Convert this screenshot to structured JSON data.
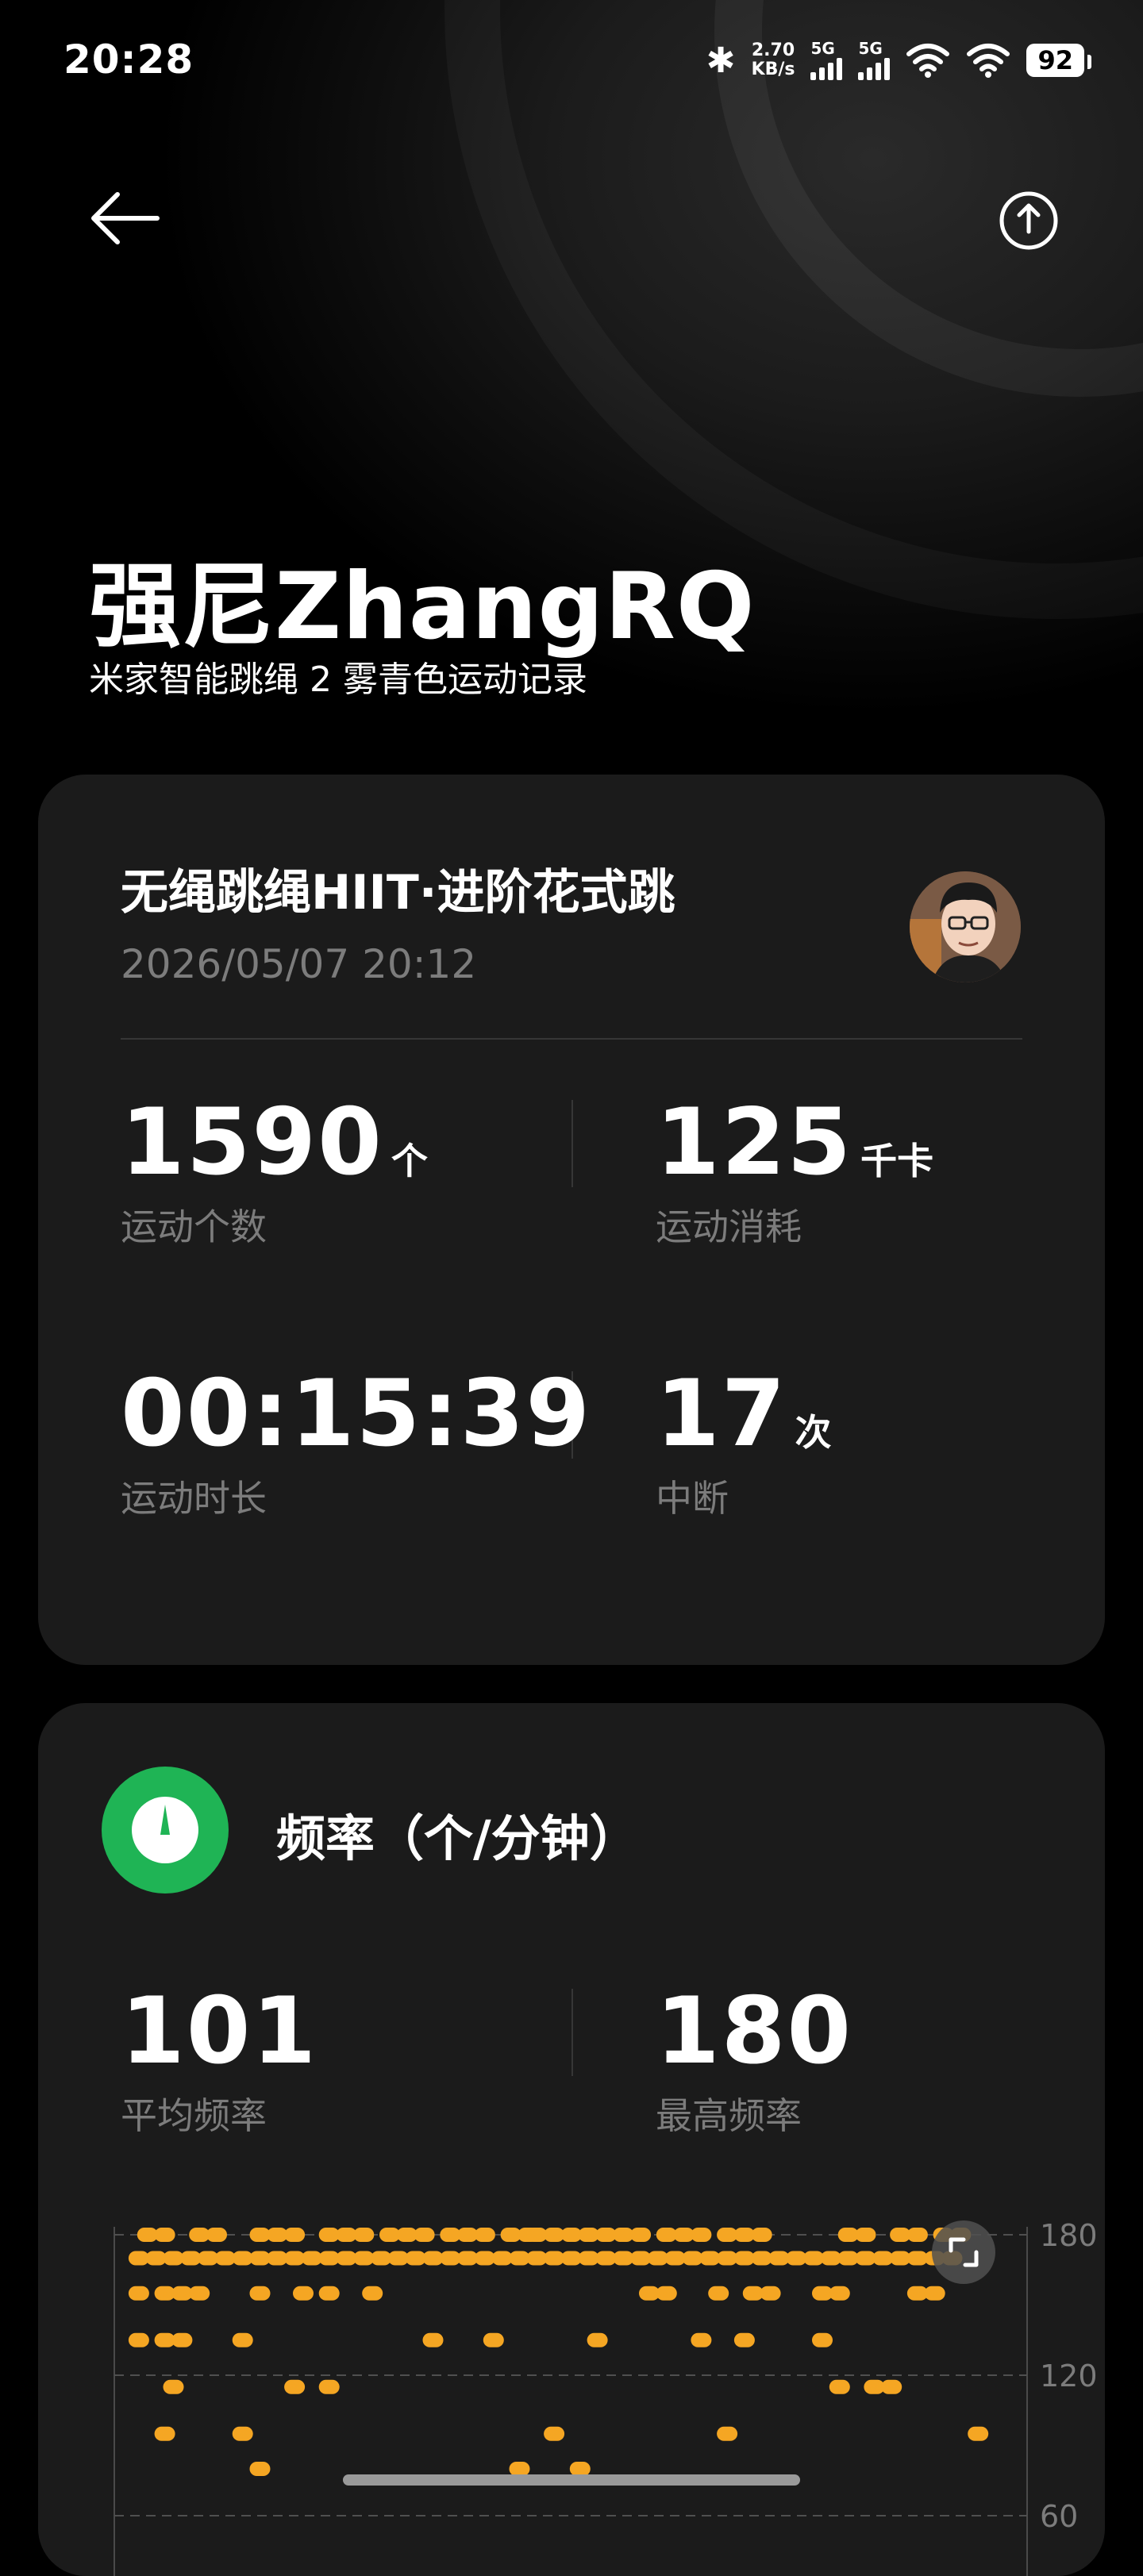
{
  "status_bar": {
    "time": "20:28",
    "net_speed_value": "2.70",
    "net_speed_unit": "KB/s",
    "sim1_label": "5G",
    "sim2_label": "5G",
    "battery": "92",
    "icons": [
      "bluetooth-icon",
      "signal-icon",
      "wifi-icon",
      "battery-icon"
    ]
  },
  "nav": {
    "back_icon": "arrow-left-icon",
    "share_icon": "share-icon"
  },
  "header": {
    "title": "强尼ZhangRQ",
    "subtitle": "米家智能跳绳 2 雾青色运动记录"
  },
  "workout": {
    "title": "无绳跳绳HIIT·进阶花式跳",
    "datetime": "2026/05/07 20:12",
    "stats": [
      {
        "value": "1590",
        "unit": "个",
        "label": "运动个数"
      },
      {
        "value": "125",
        "unit": "千卡",
        "label": "运动消耗"
      },
      {
        "value": "00:15:39",
        "unit": "",
        "label": "运动时长"
      },
      {
        "value": "17",
        "unit": "次",
        "label": "中断"
      }
    ]
  },
  "frequency": {
    "icon": "speedometer-icon",
    "title": "频率（个/分钟）",
    "stats": [
      {
        "value": "101",
        "label": "平均频率"
      },
      {
        "value": "180",
        "label": "最高频率"
      }
    ]
  },
  "chart_data": {
    "type": "scatter",
    "title": "",
    "xlabel": "",
    "ylabel": "",
    "y_ticks": [
      180,
      120,
      60
    ],
    "grid": true,
    "color": "#f5a623",
    "rows": [
      {
        "y": 180,
        "x": [
          0.02,
          0.04,
          0.08,
          0.1,
          0.15,
          0.17,
          0.19,
          0.23,
          0.25,
          0.27,
          0.3,
          0.32,
          0.34,
          0.37,
          0.39,
          0.41,
          0.44,
          0.46,
          0.47,
          0.49,
          0.51,
          0.53,
          0.55,
          0.57,
          0.59,
          0.62,
          0.64,
          0.66,
          0.69,
          0.71,
          0.73,
          0.83,
          0.85,
          0.89,
          0.91,
          0.94,
          0.96
        ]
      },
      {
        "y": 170,
        "x": [
          0.01,
          0.03,
          0.05,
          0.07,
          0.09,
          0.11,
          0.13,
          0.15,
          0.17,
          0.19,
          0.21,
          0.23,
          0.25,
          0.27,
          0.29,
          0.31,
          0.33,
          0.35,
          0.37,
          0.39,
          0.41,
          0.43,
          0.45,
          0.47,
          0.49,
          0.51,
          0.53,
          0.55,
          0.57,
          0.59,
          0.61,
          0.63,
          0.65,
          0.67,
          0.69,
          0.71,
          0.73,
          0.75,
          0.77,
          0.79,
          0.81,
          0.83,
          0.85,
          0.87,
          0.89,
          0.91,
          0.93,
          0.95
        ]
      },
      {
        "y": 155,
        "x": [
          0.01,
          0.04,
          0.06,
          0.08,
          0.15,
          0.2,
          0.23,
          0.28,
          0.6,
          0.62,
          0.68,
          0.72,
          0.74,
          0.8,
          0.82,
          0.91,
          0.93
        ]
      },
      {
        "y": 135,
        "x": [
          0.01,
          0.04,
          0.06,
          0.13,
          0.35,
          0.42,
          0.54,
          0.66,
          0.71,
          0.8
        ]
      },
      {
        "y": 115,
        "x": [
          0.05,
          0.19,
          0.23,
          0.82,
          0.86,
          0.88
        ]
      },
      {
        "y": 95,
        "x": [
          0.04,
          0.13,
          0.49,
          0.69,
          0.98
        ]
      },
      {
        "y": 80,
        "x": [
          0.15,
          0.45,
          0.52
        ]
      }
    ]
  }
}
